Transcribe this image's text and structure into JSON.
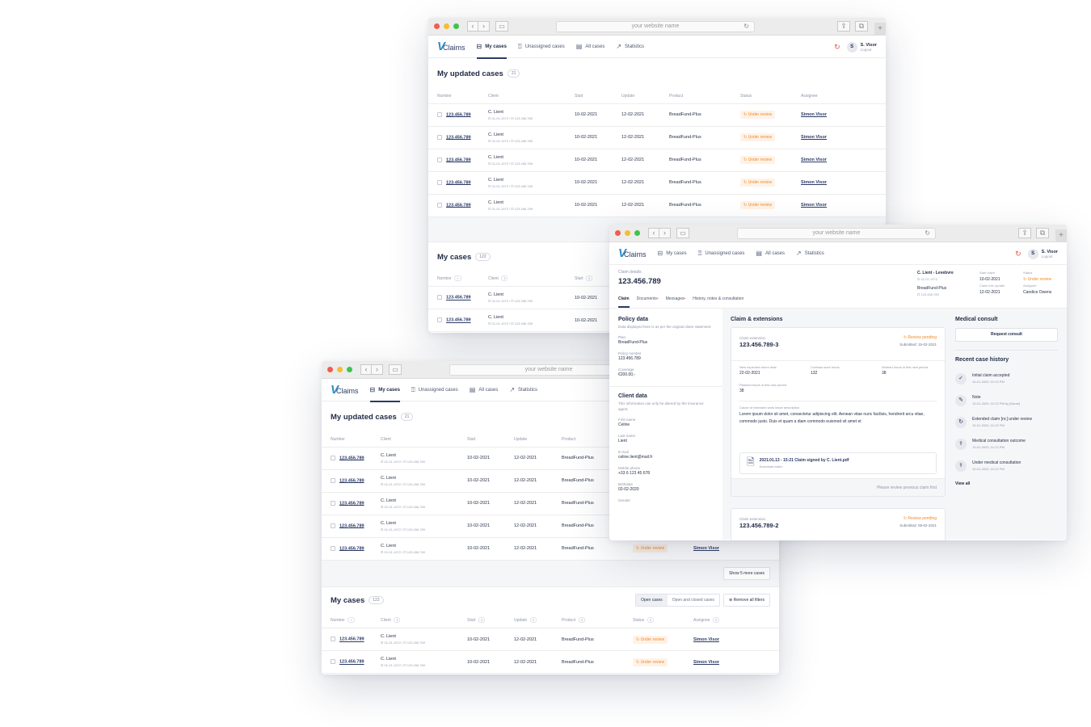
{
  "browser": {
    "url_text": "your website name",
    "back": "‹",
    "forward": "›",
    "plus": "+"
  },
  "app": {
    "logo_mark": "V",
    "logo_text": "Claims",
    "nav": [
      {
        "label": "My cases"
      },
      {
        "label": "Unassigned cases"
      },
      {
        "label": "All cases"
      },
      {
        "label": "Statistics"
      }
    ],
    "user_initial": "S",
    "user_name": "S. Visor",
    "user_action": "Logout"
  },
  "updated_cases": {
    "title": "My updated cases",
    "count": "21",
    "columns": {
      "number": "Number",
      "client": "Client",
      "start": "Start",
      "update": "Update",
      "product": "Product",
      "status": "Status",
      "assignee": "Assignee"
    },
    "rows": [
      {
        "number": "123.456.789",
        "client": "C. Lient",
        "client_sub": "⊡ 01-01-1972  /  ⊡ 123.456.789",
        "start": "10-02-2021",
        "update": "12-02-2021",
        "product": "BreadFund-Plus",
        "status": "Under review",
        "assignee": "Simon Visor"
      },
      {
        "number": "123.456.789",
        "client": "C. Lient",
        "client_sub": "⊡ 01-01-1972  /  ⊡ 123.456.789",
        "start": "10-02-2021",
        "update": "12-02-2021",
        "product": "BreadFund-Plus",
        "status": "Under review",
        "assignee": "Simon Visor"
      },
      {
        "number": "123.456.789",
        "client": "C. Lient",
        "client_sub": "⊡ 01-01-1972  /  ⊡ 123.456.789",
        "start": "10-02-2021",
        "update": "12-02-2021",
        "product": "BreadFund-Plus",
        "status": "Under review",
        "assignee": "Simon Visor"
      },
      {
        "number": "123.456.789",
        "client": "C. Lient",
        "client_sub": "⊡ 01-01-1972  /  ⊡ 123.456.789",
        "start": "10-02-2021",
        "update": "12-02-2021",
        "product": "BreadFund-Plus",
        "status": "Under review",
        "assignee": "Simon Visor"
      },
      {
        "number": "123.456.789",
        "client": "C. Lient",
        "client_sub": "⊡ 01-01-1972  /  ⊡ 123.456.789",
        "start": "10-02-2021",
        "update": "12-02-2021",
        "product": "BreadFund-Plus",
        "status": "Under review",
        "assignee": "Simon Visor"
      }
    ],
    "show_more": "Show 5 more cases"
  },
  "my_cases": {
    "title": "My cases",
    "count": "122",
    "filter_open": "Open cases",
    "filter_all": "Open and closed cases",
    "remove_filters": "Remove all filters",
    "sort_num": "+",
    "sort_count": "3",
    "rows": [
      {
        "number": "123.456.789",
        "client": "C. Lient",
        "client_sub": "⊡ 01-01-1972  /  ⊡ 123.456.789",
        "start": "10-02-2021",
        "update": "12-02-2021",
        "product": "BreadFund-Plus",
        "status": "Under review",
        "assignee": "Simon Visor"
      },
      {
        "number": "123.456.789",
        "client": "C. Lient",
        "client_sub": "⊡ 01-01-1972  /  ⊡ 123.456.789",
        "start": "10-02-2021",
        "update": "12-02-2021",
        "product": "BreadFund-Plus",
        "status": "Under review",
        "assignee": "Simon Visor"
      }
    ]
  },
  "detail": {
    "crumb": "Claim details",
    "number": "123.456.789",
    "tabs": [
      {
        "label": "Claim"
      },
      {
        "label": "Documents"
      },
      {
        "label": "Messages"
      },
      {
        "label": "History, notes & consultation"
      }
    ],
    "client_name": "C. Lient - Levebvre",
    "client_dob": "⊡ 01-01-1972",
    "client_product": "BreadFund-Plus",
    "client_id": "⊡ 123.456.789",
    "start_label": "Start claim",
    "start_value": "10-02-2021",
    "status_label": "Status",
    "status_value": "Under review",
    "last_update_label": "Claim info update",
    "last_update_value": "12-02-2021",
    "assignee_label": "Assignee",
    "assignee_value": "Candice Owens",
    "policy": {
      "title": "Policy data",
      "desc": "Data displayed here is as per the original claim statement.",
      "plan_label": "Plan",
      "plan": "BreadFund-Plus",
      "policy_number_label": "Policy number",
      "policy_number": "123.456.789",
      "coverage_label": "Coverage",
      "coverage": "€200.00,-"
    },
    "client": {
      "title": "Client data",
      "desc": "This information can only be altered by the insurance agent.",
      "first_name_label": "First name",
      "first_name": "Celine",
      "last_name_label": "Last name",
      "last_name": "Lient",
      "email_label": "E-mail",
      "email": "celine.lient@mail.fr",
      "phone_label": "Mobile phone",
      "phone": "+33 6 123 45 678",
      "birthdate_label": "Birthdate",
      "birthdate": "02-02-2020",
      "gender_label": "Gender"
    },
    "claims": {
      "title": "Claim & extensions",
      "card1": {
        "label": "Claim extension",
        "number": "123.456.789-3",
        "status": "Review pending",
        "submitted": "Submitted: 15-02-2021",
        "f1_label": "New expected return date",
        "f1": "22-02-2021",
        "f2_label": "Contract work hours",
        "f2": "132",
        "f3_label": "Worked hours in this new period",
        "f3": "38",
        "f4_label": "Planned hours in this new period",
        "f4": "38",
        "cause_label": "Cause of extended work leave description",
        "cause": "Lorem ipsum dolor sit amet, consectetur adipiscing elit. Aenean vitae nunc facilisis, hendrerit arcu vitae, commodo justo. Duis et quam a diam commodo euismod sit amet et",
        "file_title": "2021.01.13 - 15:21  Claim signed by C. Lient.pdf",
        "file_sub": "Download claim",
        "footer": "Please review previous claim first"
      },
      "card2": {
        "label": "Claim extension",
        "number": "123.456.789-2",
        "status": "Review pending",
        "submitted": "Submitted: 08-02-2021"
      }
    },
    "consult": {
      "title": "Medical consult",
      "button": "Request consult",
      "history_title": "Recent case history",
      "items": [
        {
          "title": "Initial claim accepted",
          "date": "10-01-2020, 01:22 PM"
        },
        {
          "title": "Note",
          "date": "10-01-2020, 01:22 PM by [Name]"
        },
        {
          "title": "Extended claim [nr.] under review",
          "date": "10-01-2020, 01:22 PM"
        },
        {
          "title": "Medical consultation outcome",
          "date": "10-01-2020, 01:22 PM"
        },
        {
          "title": "Under medical consultation",
          "date": "10-01-2020, 01:22 PM"
        }
      ],
      "view_all": "View all"
    }
  }
}
